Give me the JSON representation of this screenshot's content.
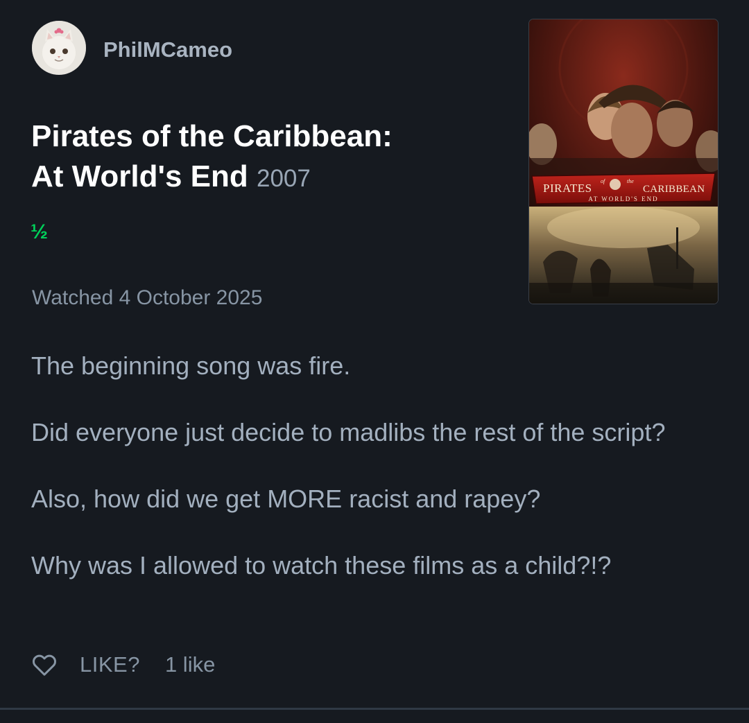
{
  "reviewer": {
    "username": "PhilMCameo",
    "avatar_icon": "cat-avatar"
  },
  "film": {
    "title_line1": "Pirates of the Caribbean:",
    "title_line2": "At World's End",
    "year": "2007",
    "poster": {
      "title_left": "PIRATES",
      "title_of": "of",
      "title_the": "the",
      "title_right": "CARIBBEAN",
      "subtitle": "AT WORLD'S END"
    }
  },
  "rating": {
    "display": "½",
    "stars": 0.5,
    "max_stars": 5,
    "color": "#00d05a"
  },
  "watched": {
    "label": "Watched 4 October 2025"
  },
  "review": {
    "paragraphs": [
      "The beginning song was fire.",
      "Did everyone just decide to madlibs the rest of the script?",
      "Also, how did we get MORE racist and rapey?",
      "Why was I allowed to watch these films as a child?!?"
    ]
  },
  "footer": {
    "heart_icon": "heart-outline-icon",
    "like_label": "LIKE?",
    "like_count": "1 like"
  },
  "colors": {
    "background": "#161a20",
    "accent_green": "#00d05a",
    "text_muted": "#8795a4",
    "text_body": "#a3b0bf"
  }
}
